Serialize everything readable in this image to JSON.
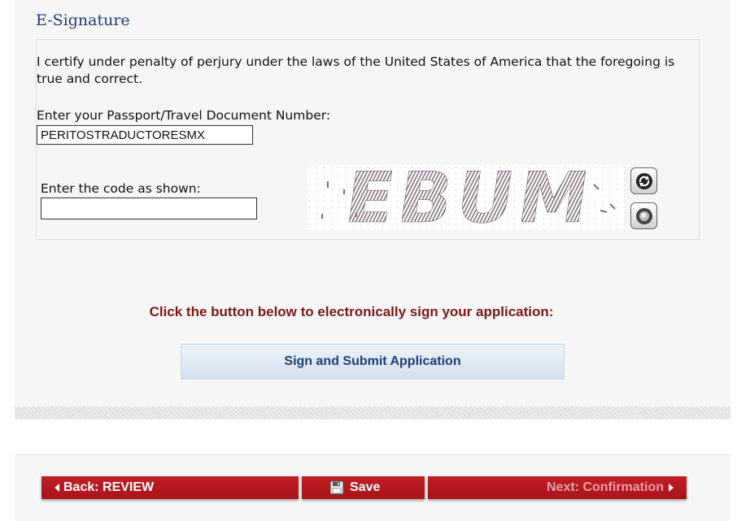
{
  "section": {
    "title": "E-Signature"
  },
  "certify_text": "I certify under penalty of perjury under the laws of the United States of America that the foregoing is true and correct.",
  "passport": {
    "label": "Enter your Passport/Travel Document Number:",
    "value": "PERITOSTRADUCTORESMX"
  },
  "captcha": {
    "label": "Enter the code as shown:",
    "value": "",
    "image_text": "EBUM",
    "refresh_icon": "refresh-icon",
    "audio_icon": "audio-icon"
  },
  "instruction": "Click the button below to electronically sign your application:",
  "sign_button": "Sign and Submit Application",
  "nav": {
    "back_label": "Back: REVIEW",
    "save_label": "Save",
    "next_label": "Next: Confirmation"
  },
  "colors": {
    "title": "#1f3e72",
    "instruction": "#7a1818",
    "nav_button": "#b0161e",
    "next_text_disabled": "#e8a3a6"
  }
}
